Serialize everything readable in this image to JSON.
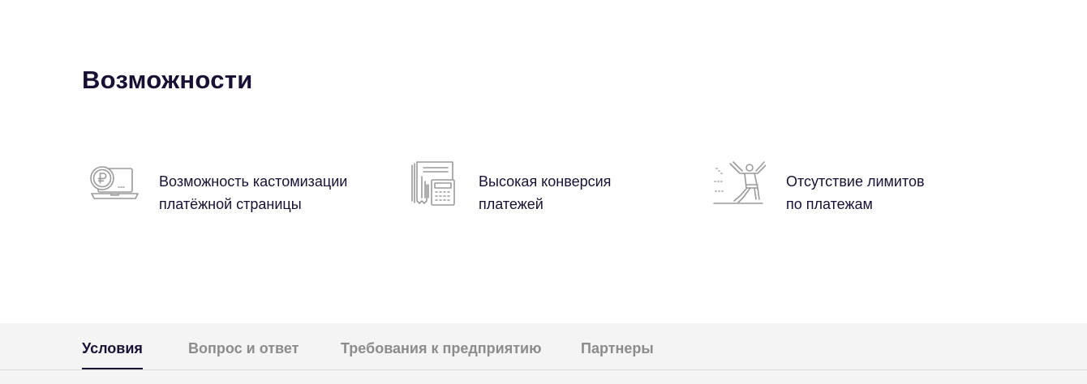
{
  "section": {
    "title": "Возможности"
  },
  "features": [
    {
      "icon": "laptop-ruble-icon",
      "text": "Возможность кастомизации платёжной страницы"
    },
    {
      "icon": "receipt-calculator-icon",
      "text": "Высокая конверсия платежей"
    },
    {
      "icon": "jumping-person-icon",
      "text": "Отсутствие лимитов по платежам"
    }
  ],
  "tabs": [
    {
      "label": "Условия",
      "active": true
    },
    {
      "label": "Вопрос и ответ",
      "active": false
    },
    {
      "label": "Требования к предприятию",
      "active": false
    },
    {
      "label": "Партнеры",
      "active": false
    }
  ],
  "colors": {
    "text": "#1a1033",
    "icon": "#9a9a9a",
    "tab_inactive": "#8c8c8c",
    "tab_bar_bg": "#f4f4f4"
  }
}
